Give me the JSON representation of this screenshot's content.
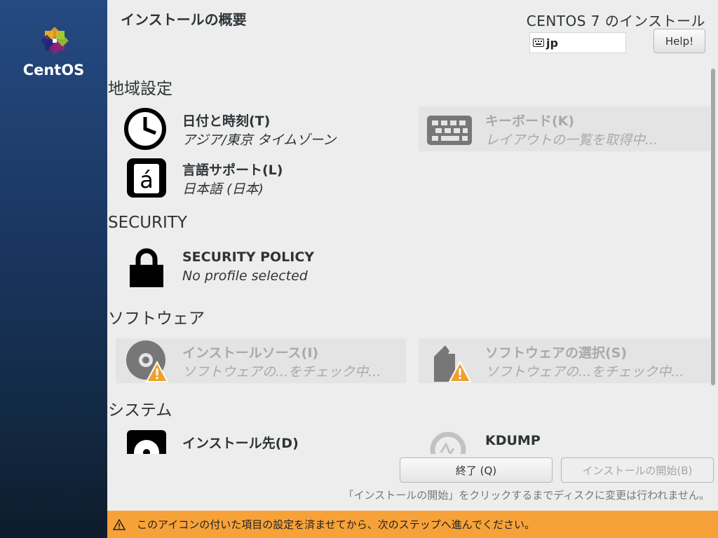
{
  "sidebar": {
    "brand": "CentOS"
  },
  "header": {
    "title": "インストールの概要",
    "product_title": "CENTOS 7 のインストール",
    "keyboard_layout": "jp",
    "help_label": "Help!"
  },
  "hub": {
    "sections": [
      {
        "title": "地域設定"
      },
      {
        "title": "SECURITY"
      },
      {
        "title": "ソフトウェア"
      },
      {
        "title": "システム"
      }
    ],
    "spokes": {
      "datetime": {
        "title": "日付と時刻(T)",
        "status": "アジア/東京 タイムゾーン"
      },
      "keyboard": {
        "title": "キーボード(K)",
        "status": "レイアウトの一覧を取得中..."
      },
      "language": {
        "title": "言語サポート(L)",
        "status": "日本語 (日本)"
      },
      "security": {
        "title": "SECURITY POLICY",
        "status": "No profile selected"
      },
      "source": {
        "title": "インストールソース(I)",
        "status": "ソフトウェアの...をチェック中..."
      },
      "software": {
        "title": "ソフトウェアの選択(S)",
        "status": "ソフトウェアの...をチェック中..."
      },
      "destination": {
        "title": "インストール先(D)"
      },
      "kdump": {
        "title": "KDUMP"
      }
    }
  },
  "footer": {
    "quit_label": "終了 (Q)",
    "begin_label": "インストールの開始(B)",
    "note": "「インストールの開始」をクリックするまでディスクに変更は行われません。",
    "warning": "このアイコンの付いた項目の設定を済ませてから、次のステップへ進んでください。"
  },
  "colors": {
    "warning_bar": "#f7a238",
    "sidebar_top": "#254a82",
    "sidebar_bottom": "#0e1c2c"
  }
}
